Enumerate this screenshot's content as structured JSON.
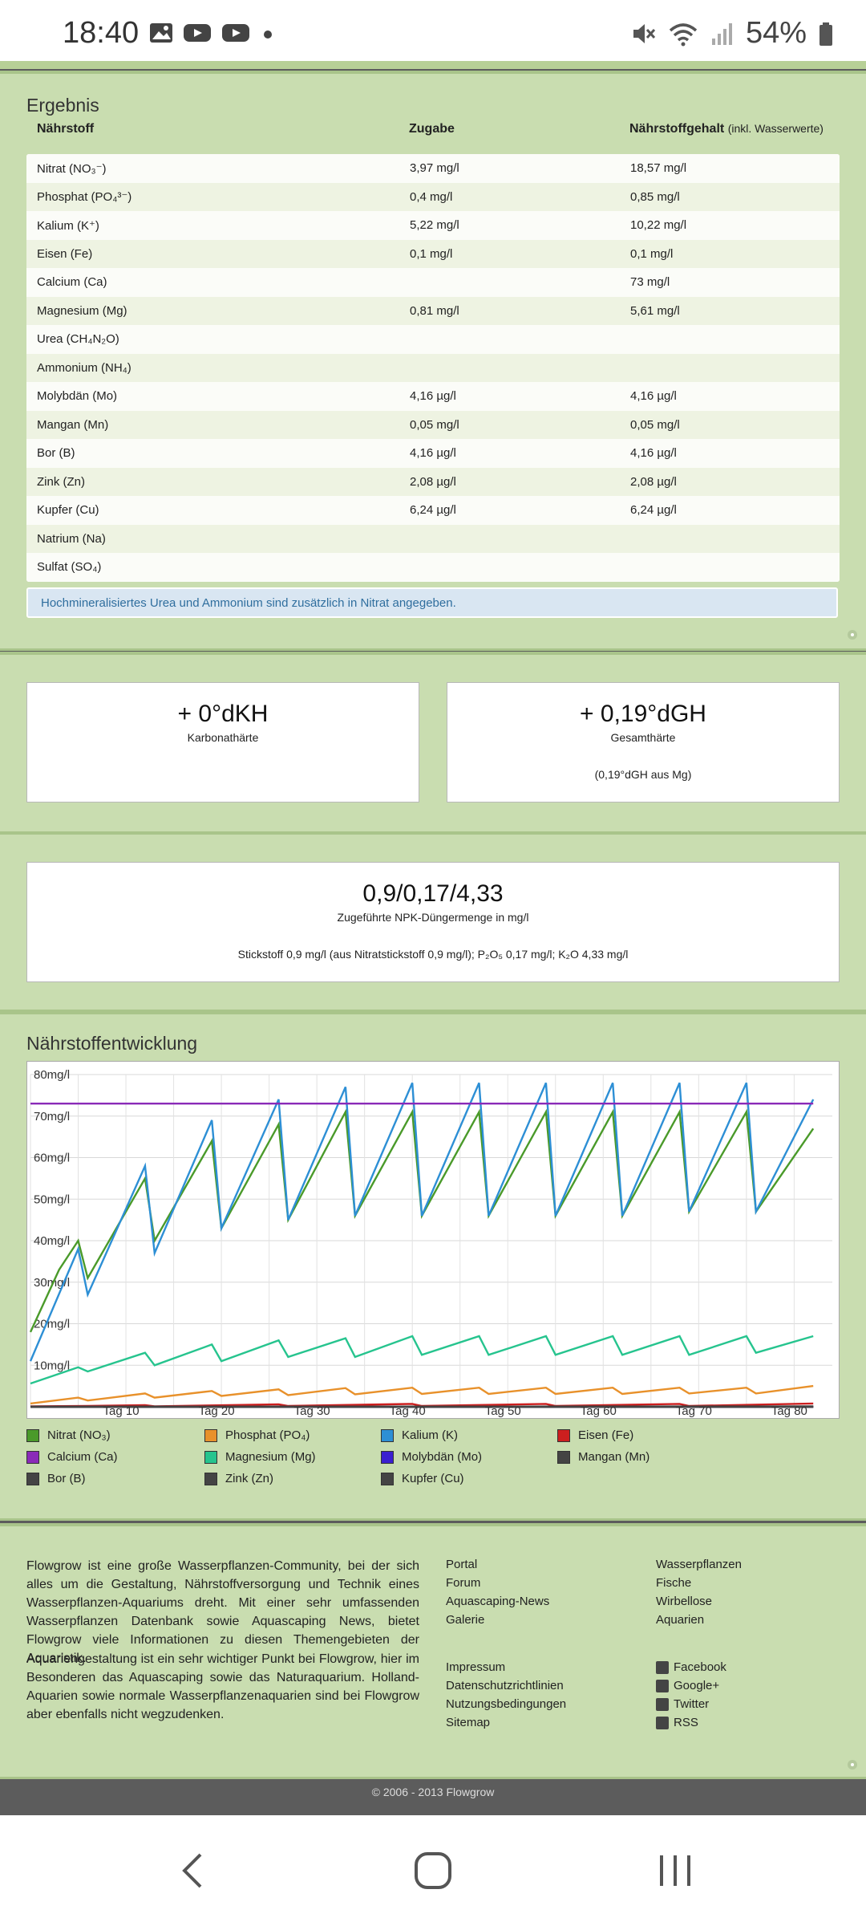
{
  "statusbar": {
    "time": "18:40",
    "battery": "54%"
  },
  "result": {
    "title": "Ergebnis",
    "headers": {
      "nutrient": "Nährstoff",
      "dose": "Zugabe",
      "content": "Nährstoffgehalt",
      "content_note": "(inkl. Wasserwerte)"
    },
    "rows": [
      {
        "n": "Nitrat (NO₃⁻)",
        "d": "3,97 mg/l",
        "c": "18,57 mg/l"
      },
      {
        "n": "Phosphat (PO₄³⁻)",
        "d": "0,4 mg/l",
        "c": "0,85 mg/l"
      },
      {
        "n": "Kalium (K⁺)",
        "d": "5,22 mg/l",
        "c": "10,22 mg/l"
      },
      {
        "n": "Eisen (Fe)",
        "d": "0,1 mg/l",
        "c": "0,1 mg/l"
      },
      {
        "n": "Calcium (Ca)",
        "d": "",
        "c": "73 mg/l"
      },
      {
        "n": "Magnesium (Mg)",
        "d": "0,81 mg/l",
        "c": "5,61 mg/l"
      },
      {
        "n": "Urea (CH₄N₂O)",
        "d": "",
        "c": ""
      },
      {
        "n": "Ammonium (NH₄)",
        "d": "",
        "c": ""
      },
      {
        "n": "Molybdän (Mo)",
        "d": "4,16 µg/l",
        "c": "4,16 µg/l"
      },
      {
        "n": "Mangan (Mn)",
        "d": "0,05 mg/l",
        "c": "0,05 mg/l"
      },
      {
        "n": "Bor (B)",
        "d": "4,16 µg/l",
        "c": "4,16 µg/l"
      },
      {
        "n": "Zink (Zn)",
        "d": "2,08 µg/l",
        "c": "2,08 µg/l"
      },
      {
        "n": "Kupfer (Cu)",
        "d": "6,24 µg/l",
        "c": "6,24 µg/l"
      },
      {
        "n": "Natrium (Na)",
        "d": "",
        "c": ""
      },
      {
        "n": "Sulfat (SO₄)",
        "d": "",
        "c": ""
      }
    ],
    "info": "Hochmineralisiertes Urea und Ammonium sind zusätzlich in Nitrat angegeben."
  },
  "hardness": {
    "kh": {
      "value": "+ 0°dKH",
      "label": "Karbonathärte"
    },
    "gh": {
      "value": "+ 0,19°dGH",
      "label": "Gesamthärte",
      "sub": "(0,19°dGH aus Mg)"
    }
  },
  "npk": {
    "value": "0,9/0,17/4,33",
    "label": "Zugeführte NPK-Düngermenge in mg/l",
    "detail": "Stickstoff 0,9 mg/l (aus Nitratstickstoff 0,9 mg/l); P₂O₅ 0,17 mg/l; K₂O 4,33 mg/l"
  },
  "chart_data": {
    "type": "line",
    "title": "Nährstoffentwicklung",
    "ylim": [
      0,
      80
    ],
    "yticks": [
      "10mg/l",
      "20mg/l",
      "30mg/l",
      "40mg/l",
      "50mg/l",
      "60mg/l",
      "70mg/l",
      "80mg/l"
    ],
    "xticks": [
      "Tag 10",
      "Tag 20",
      "Tag 30",
      "Tag 40",
      "Tag 50",
      "Tag 60",
      "Tag 70",
      "Tag 80"
    ],
    "xlim": [
      0,
      84
    ],
    "grid": true,
    "legend_position": "bottom",
    "series": [
      {
        "name": "Nitrat (NO₃)",
        "color": "#4a9a2a",
        "points": [
          [
            0,
            18
          ],
          [
            3,
            33
          ],
          [
            5,
            40
          ],
          [
            6,
            31
          ],
          [
            12,
            55
          ],
          [
            13,
            40
          ],
          [
            19,
            64
          ],
          [
            20,
            43
          ],
          [
            26,
            68
          ],
          [
            27,
            45
          ],
          [
            33,
            71
          ],
          [
            34,
            46
          ],
          [
            40,
            71
          ],
          [
            41,
            46
          ],
          [
            47,
            71
          ],
          [
            48,
            46
          ],
          [
            54,
            71
          ],
          [
            55,
            46
          ],
          [
            61,
            71
          ],
          [
            62,
            46
          ],
          [
            68,
            71
          ],
          [
            69,
            47
          ],
          [
            75,
            71
          ],
          [
            76,
            47
          ],
          [
            82,
            67
          ]
        ]
      },
      {
        "name": "Kalium (K)",
        "color": "#2d8fd5",
        "points": [
          [
            0,
            11
          ],
          [
            5,
            38
          ],
          [
            6,
            27
          ],
          [
            12,
            58
          ],
          [
            13,
            37
          ],
          [
            19,
            69
          ],
          [
            20,
            43
          ],
          [
            26,
            74
          ],
          [
            27,
            45
          ],
          [
            33,
            77
          ],
          [
            34,
            46
          ],
          [
            40,
            78
          ],
          [
            41,
            46
          ],
          [
            47,
            78
          ],
          [
            48,
            46
          ],
          [
            54,
            78
          ],
          [
            55,
            46
          ],
          [
            61,
            78
          ],
          [
            62,
            46
          ],
          [
            68,
            78
          ],
          [
            69,
            47
          ],
          [
            75,
            78
          ],
          [
            76,
            47
          ],
          [
            82,
            74
          ]
        ]
      },
      {
        "name": "Calcium (Ca)",
        "color": "#8a2ab8",
        "points": [
          [
            0,
            73
          ],
          [
            82,
            73
          ]
        ]
      },
      {
        "name": "Magnesium (Mg)",
        "color": "#26c48e",
        "points": [
          [
            0,
            5.6
          ],
          [
            5,
            9.5
          ],
          [
            6,
            8.5
          ],
          [
            12,
            13
          ],
          [
            13,
            10
          ],
          [
            19,
            15
          ],
          [
            20,
            11
          ],
          [
            26,
            16
          ],
          [
            27,
            12
          ],
          [
            33,
            16.5
          ],
          [
            34,
            12
          ],
          [
            40,
            17
          ],
          [
            41,
            12.5
          ],
          [
            47,
            17
          ],
          [
            48,
            12.5
          ],
          [
            54,
            17
          ],
          [
            55,
            12.5
          ],
          [
            61,
            17
          ],
          [
            62,
            12.5
          ],
          [
            68,
            17
          ],
          [
            69,
            12.5
          ],
          [
            75,
            17
          ],
          [
            76,
            13
          ],
          [
            82,
            17
          ]
        ]
      },
      {
        "name": "Phosphat (PO₄)",
        "color": "#e8912b",
        "points": [
          [
            0,
            0.8
          ],
          [
            5,
            2.2
          ],
          [
            6,
            1.5
          ],
          [
            12,
            3.2
          ],
          [
            13,
            2.2
          ],
          [
            19,
            3.8
          ],
          [
            20,
            2.6
          ],
          [
            26,
            4.2
          ],
          [
            27,
            2.8
          ],
          [
            33,
            4.5
          ],
          [
            34,
            3
          ],
          [
            40,
            4.6
          ],
          [
            41,
            3.1
          ],
          [
            47,
            4.6
          ],
          [
            48,
            3.1
          ],
          [
            54,
            4.6
          ],
          [
            55,
            3.1
          ],
          [
            61,
            4.6
          ],
          [
            62,
            3.1
          ],
          [
            68,
            4.6
          ],
          [
            69,
            3.2
          ],
          [
            75,
            4.6
          ],
          [
            76,
            3.2
          ],
          [
            82,
            5
          ]
        ]
      },
      {
        "name": "Eisen (Fe)",
        "color": "#cc1f1f",
        "points": [
          [
            0,
            0.1
          ],
          [
            6,
            0.2
          ],
          [
            12,
            0.4
          ],
          [
            13,
            0.1
          ],
          [
            26,
            0.6
          ],
          [
            27,
            0.2
          ],
          [
            40,
            0.7
          ],
          [
            41,
            0.2
          ],
          [
            54,
            0.7
          ],
          [
            55,
            0.2
          ],
          [
            68,
            0.7
          ],
          [
            69,
            0.2
          ],
          [
            82,
            0.8
          ]
        ]
      },
      {
        "name": "Molybdän (Mo)",
        "color": "#3a1fd0",
        "points": [
          [
            0,
            0
          ],
          [
            82,
            0
          ]
        ]
      },
      {
        "name": "Mangan (Mn)",
        "color": "#444444",
        "points": [
          [
            0,
            0
          ],
          [
            82,
            0.1
          ]
        ]
      },
      {
        "name": "Bor (B)",
        "color": "#444444",
        "points": [
          [
            0,
            0
          ],
          [
            82,
            0
          ]
        ]
      },
      {
        "name": "Zink (Zn)",
        "color": "#444444",
        "points": [
          [
            0,
            0
          ],
          [
            82,
            0
          ]
        ]
      },
      {
        "name": "Kupfer (Cu)",
        "color": "#444444",
        "points": [
          [
            0,
            0
          ],
          [
            82,
            0
          ]
        ]
      }
    ]
  },
  "legend": [
    {
      "label": "Nitrat (NO₃)",
      "color": "#4a9a2a"
    },
    {
      "label": "Phosphat (PO₄)",
      "color": "#e8912b"
    },
    {
      "label": "Kalium (K)",
      "color": "#2d8fd5"
    },
    {
      "label": "Eisen (Fe)",
      "color": "#cc1f1f"
    },
    {
      "label": "Calcium (Ca)",
      "color": "#8a2ab8"
    },
    {
      "label": "Magnesium (Mg)",
      "color": "#26c48e"
    },
    {
      "label": "Molybdän (Mo)",
      "color": "#3a1fd0"
    },
    {
      "label": "Mangan (Mn)",
      "color": "#444444"
    },
    {
      "label": "Bor (B)",
      "color": "#444444"
    },
    {
      "label": "Zink (Zn)",
      "color": "#444444"
    },
    {
      "label": "Kupfer (Cu)",
      "color": "#444444"
    }
  ],
  "footer": {
    "p1": "Flowgrow ist eine große Wasserpflanzen-Community, bei der sich alles um die Gestaltung, Nährstoffversorgung und Technik eines Wasserpflanzen-Aquariums dreht. Mit einer sehr umfassenden Wasserpflanzen Datenbank sowie Aquascaping News, bietet Flowgrow viele Informationen zu diesen Themengebieten der Aquaristik.",
    "p2": "Aquariengestaltung ist ein sehr wichtiger Punkt bei Flowgrow, hier im Besonderen das Aquascaping sowie das Naturaquarium. Holland-Aquarien sowie normale Wasserpflanzenaquarien sind bei Flowgrow aber ebenfalls nicht wegzudenken.",
    "col1a": [
      "Portal",
      "Forum",
      "Aquascaping-News",
      "Galerie"
    ],
    "col2a": [
      "Wasserpflanzen",
      "Fische",
      "Wirbellose",
      "Aquarien"
    ],
    "col1b": [
      "Impressum",
      "Datenschutzrichtlinien",
      "Nutzungsbedingungen",
      "Sitemap"
    ],
    "social": [
      {
        "label": "Facebook",
        "icon": "facebook-icon"
      },
      {
        "label": "Google+",
        "icon": "googleplus-icon"
      },
      {
        "label": "Twitter",
        "icon": "twitter-icon"
      },
      {
        "label": "RSS",
        "icon": "rss-icon"
      }
    ],
    "copyright": "© 2006 - 2013 Flowgrow"
  }
}
